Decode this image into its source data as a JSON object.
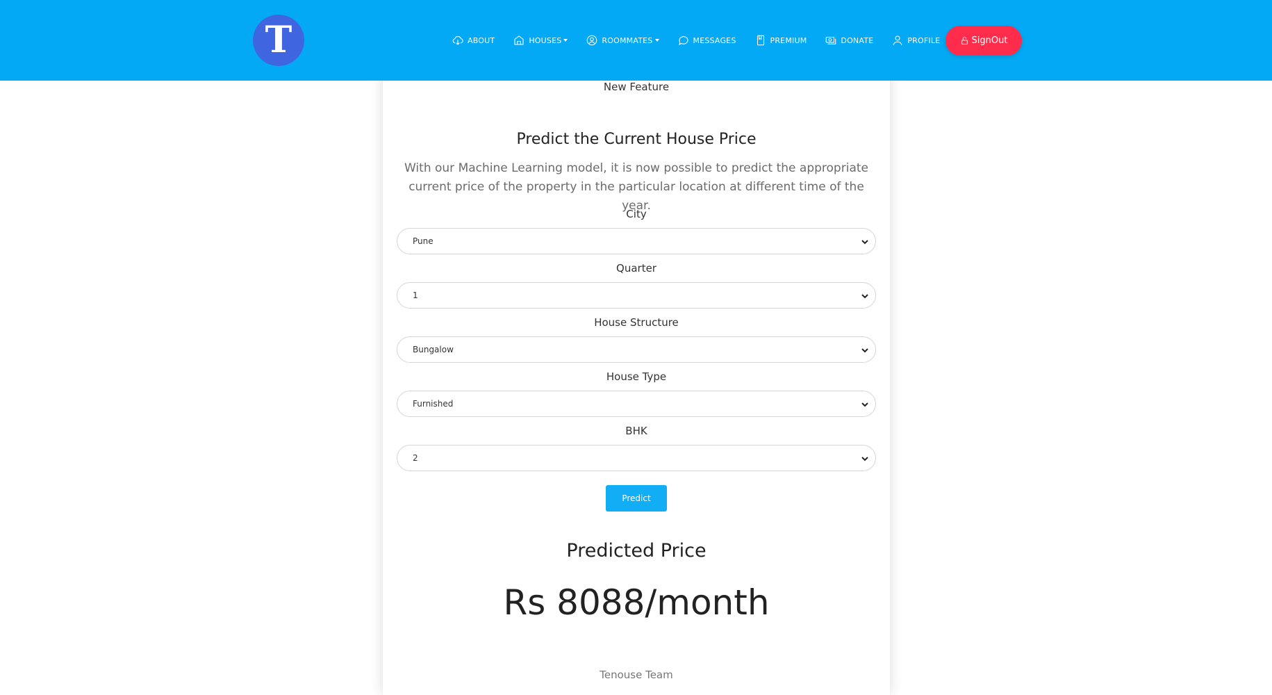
{
  "brand": {
    "logo_letter": "T"
  },
  "nav": {
    "items": [
      {
        "label": "ABOUT",
        "icon": "cloud-download-icon",
        "dropdown": false
      },
      {
        "label": "HOUSES",
        "icon": "house-icon",
        "dropdown": true
      },
      {
        "label": "ROOMMATES",
        "icon": "user-circle-icon",
        "dropdown": true
      },
      {
        "label": "MESSAGES",
        "icon": "chat-bubble-icon",
        "dropdown": false
      },
      {
        "label": "PREMIUM",
        "icon": "bookmark-icon",
        "dropdown": false
      },
      {
        "label": "DONATE",
        "icon": "money-icon",
        "dropdown": false
      },
      {
        "label": "PROFILE",
        "icon": "person-icon",
        "dropdown": false
      }
    ],
    "signout_label": "SignOut",
    "signout_icon": "lock-icon"
  },
  "card": {
    "feature_label": "New Feature",
    "title": "Predict the Current House Price",
    "description": "With our Machine Learning model, it is now possible to predict the appropriate current price of the property in the particular location at different time of the year.",
    "fields": [
      {
        "label": "City",
        "value": "Pune"
      },
      {
        "label": "Quarter",
        "value": "1"
      },
      {
        "label": "House Structure",
        "value": "Bungalow"
      },
      {
        "label": "House Type",
        "value": "Furnished"
      },
      {
        "label": "BHK",
        "value": "2"
      }
    ],
    "predict_label": "Predict",
    "predicted_title": "Predicted Price",
    "predicted_value": "Rs 8088/month",
    "footer": "Tenouse Team"
  },
  "colors": {
    "navbar": "#03a9f4",
    "logo": "#3f66e0",
    "signout": "#ff2d4b",
    "predict_button": "#12aef5"
  }
}
